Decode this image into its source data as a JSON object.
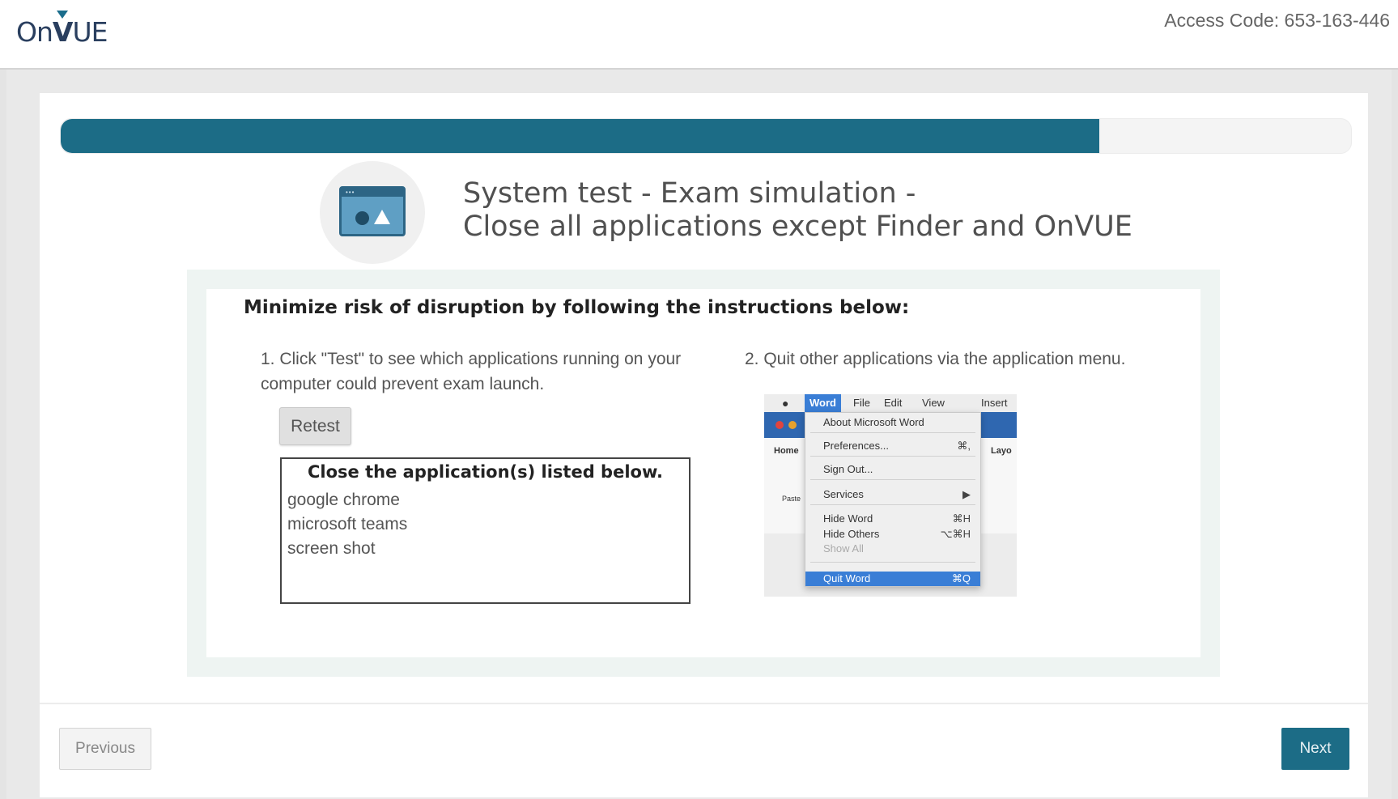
{
  "header": {
    "logo": {
      "on": "On",
      "v": "V",
      "ue": "UE"
    },
    "access_code": "Access Code: 653-163-446"
  },
  "progress": {
    "fraction": 0.805,
    "color": "#1c6c86"
  },
  "page": {
    "icon": "app-window-icon",
    "title_line1": "System test - Exam simulation -",
    "title_line2": "Close all applications except Finder and OnVUE"
  },
  "instructions": {
    "heading": "Minimize risk of disruption by following the instructions below:",
    "step1": "1. Click \"Test\" to see which applications running on your computer could prevent exam launch.",
    "step2": "2. Quit other applications via the application menu.",
    "retest_label": "Retest",
    "apps_box": {
      "title": "Close the application(s) listed below.",
      "apps": [
        "google chrome",
        "microsoft teams",
        "screen shot"
      ]
    }
  },
  "menu_screenshot": {
    "menubar": [
      "Word",
      "File",
      "Edit",
      "View",
      "Insert"
    ],
    "ribbon": [
      "Home",
      "Layo",
      "Paste"
    ],
    "items": [
      {
        "label": "About Microsoft Word",
        "shortcut": ""
      },
      {
        "label": "Preferences...",
        "shortcut": "⌘,"
      },
      {
        "label": "Sign Out...",
        "shortcut": ""
      },
      {
        "label": "Services",
        "shortcut": "▶"
      },
      {
        "label": "Hide Word",
        "shortcut": "⌘H"
      },
      {
        "label": "Hide Others",
        "shortcut": "⌥⌘H"
      },
      {
        "label": "Show All",
        "shortcut": ""
      }
    ],
    "quit": {
      "label": "Quit Word",
      "shortcut": "⌘Q"
    }
  },
  "footer": {
    "previous_label": "Previous",
    "next_label": "Next"
  },
  "colors": {
    "accent": "#1c6c86",
    "panel_bg": "#eef4f2",
    "menu_highlight": "#3a7ed6"
  }
}
